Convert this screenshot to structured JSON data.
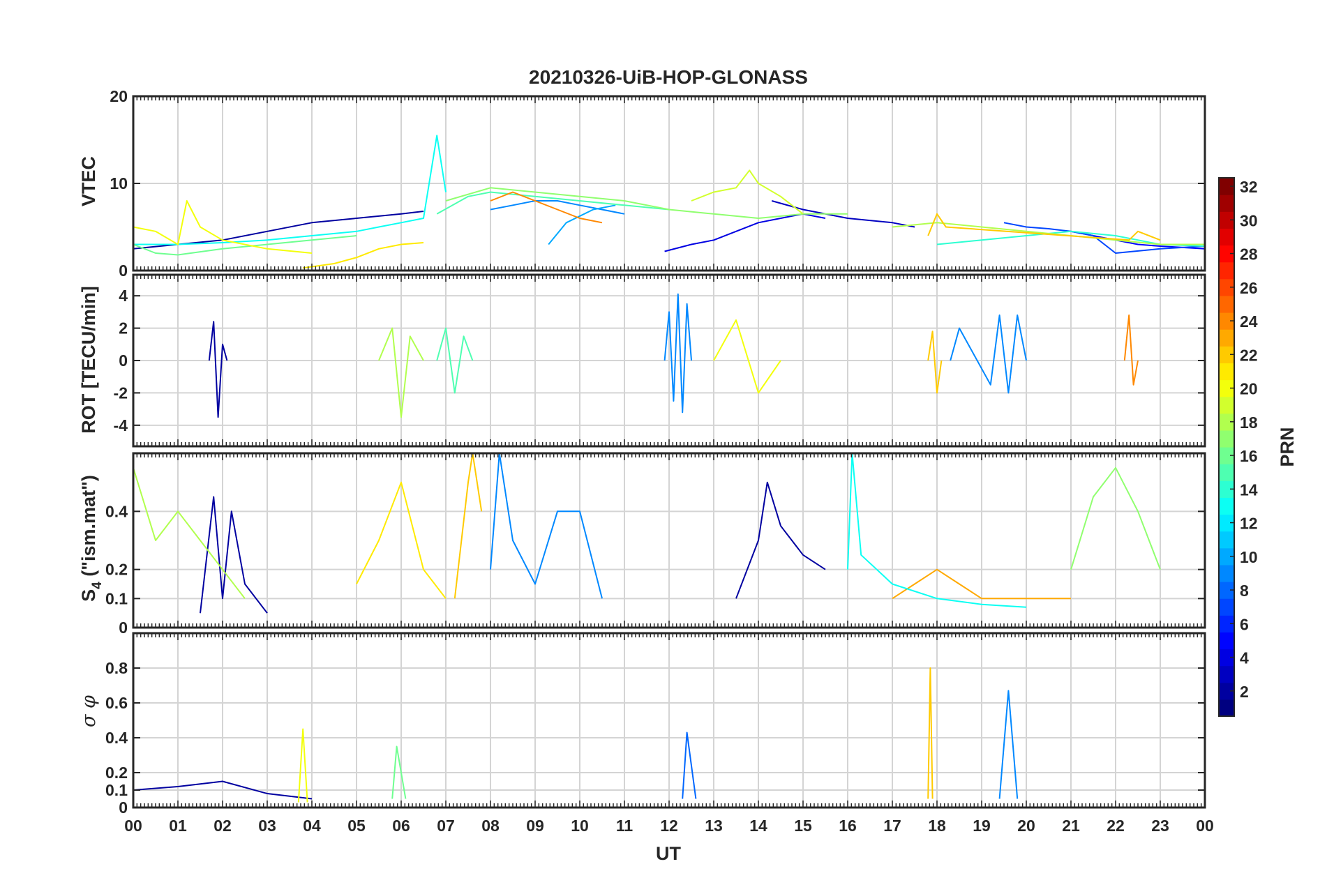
{
  "chart_data": {
    "type": "line",
    "title": "20210326-UiB-HOP-GLONASS",
    "xlabel": "UT",
    "x_unit": "hours",
    "xlim": [
      0,
      24
    ],
    "x_tick_labels": [
      "00",
      "01",
      "02",
      "03",
      "04",
      "05",
      "06",
      "07",
      "08",
      "09",
      "10",
      "11",
      "12",
      "13",
      "14",
      "15",
      "16",
      "17",
      "18",
      "19",
      "20",
      "21",
      "22",
      "23",
      "00"
    ],
    "grid": true,
    "colorbar": {
      "label": "PRN",
      "colormap": "jet",
      "range": [
        1,
        32
      ],
      "tick_labels": [
        "2",
        "4",
        "6",
        "8",
        "10",
        "12",
        "14",
        "16",
        "18",
        "20",
        "22",
        "24",
        "26",
        "28",
        "30",
        "32"
      ]
    },
    "panels": [
      {
        "id": "vtec",
        "ylabel": "VTEC",
        "ylim": [
          0,
          20
        ],
        "y_ticks": [
          0,
          10,
          20
        ],
        "y_tick_labels": [
          "0",
          "10",
          "20"
        ],
        "series": [
          {
            "prn": 2,
            "x": [
              0,
              1,
              2,
              3,
              4,
              5,
              6,
              6.5
            ],
            "y": [
              2.5,
              3,
              3.5,
              4.5,
              5.5,
              6,
              6.5,
              6.8
            ]
          },
          {
            "prn": 3,
            "x": [
              14.3,
              15,
              16,
              17,
              17.5
            ],
            "y": [
              8,
              7,
              6,
              5.5,
              5
            ]
          },
          {
            "prn": 4,
            "x": [
              11.9,
              12.5,
              13,
              13.5,
              14,
              14.5,
              15,
              15.5
            ],
            "y": [
              2.2,
              3,
              3.5,
              4.5,
              5.5,
              6,
              6.5,
              6
            ]
          },
          {
            "prn": 5,
            "x": [
              21,
              21.5,
              22,
              22.5,
              23,
              24
            ],
            "y": [
              4.5,
              4,
              3.5,
              3,
              2.8,
              2.5
            ]
          },
          {
            "prn": 7,
            "x": [
              19.5,
              20,
              20.5,
              21,
              21.5,
              22,
              23,
              24
            ],
            "y": [
              5.5,
              5,
              4.8,
              4.5,
              4,
              2,
              2.5,
              2.8
            ]
          },
          {
            "prn": 9,
            "x": [
              8,
              8.5,
              9,
              9.5,
              10,
              10.5,
              11
            ],
            "y": [
              7,
              7.5,
              8,
              8,
              7.5,
              7,
              6.5
            ]
          },
          {
            "prn": 10,
            "x": [
              9.3,
              9.7,
              10.3,
              10.8
            ],
            "y": [
              3,
              5.5,
              7,
              7.5
            ]
          },
          {
            "prn": 13,
            "x": [
              0,
              1,
              2,
              3,
              4,
              5,
              5.5,
              6,
              6.5,
              6.8,
              7
            ],
            "y": [
              3,
              3,
              3.2,
              3.5,
              4,
              4.5,
              5,
              5.5,
              6,
              15.5,
              9
            ]
          },
          {
            "prn": 14,
            "x": [
              18,
              19,
              20,
              21,
              22,
              23,
              24
            ],
            "y": [
              3,
              3.5,
              4,
              4.5,
              4,
              3,
              2.8
            ]
          },
          {
            "prn": 15,
            "x": [
              6.8,
              7.5,
              8,
              9,
              10,
              11,
              12
            ],
            "y": [
              6.5,
              8.5,
              9,
              8.5,
              8,
              7.5,
              7
            ]
          },
          {
            "prn": 16,
            "x": [
              0,
              0.5,
              1,
              2,
              3,
              4,
              5
            ],
            "y": [
              3,
              2,
              1.8,
              2.5,
              3,
              3.5,
              4
            ]
          },
          {
            "prn": 17,
            "x": [
              7,
              8,
              9,
              10,
              11,
              12,
              13,
              14,
              15,
              16
            ],
            "y": [
              8,
              9.5,
              9,
              8.5,
              8,
              7,
              6.5,
              6,
              6.5,
              6.5
            ]
          },
          {
            "prn": 18,
            "x": [
              17,
              18,
              19,
              20,
              21,
              22,
              23,
              24
            ],
            "y": [
              5,
              5.5,
              5,
              4.5,
              4,
              3.5,
              3,
              3
            ]
          },
          {
            "prn": 19,
            "x": [
              12.5,
              13,
              13.5,
              13.8,
              14,
              14.5,
              15
            ],
            "y": [
              8,
              9,
              9.5,
              11.5,
              10,
              8.5,
              6.5
            ]
          },
          {
            "prn": 20,
            "x": [
              0,
              0.5,
              1,
              1.2,
              1.5,
              2,
              3,
              4
            ],
            "y": [
              5,
              4.5,
              3,
              8,
              5,
              3.5,
              2.5,
              2
            ]
          },
          {
            "prn": 21,
            "x": [
              3.8,
              4.5,
              5,
              5.5,
              6,
              6.5
            ],
            "y": [
              0.3,
              0.8,
              1.5,
              2.5,
              3,
              3.2
            ]
          },
          {
            "prn": 22,
            "x": [
              17.8,
              18,
              18.2,
              22.3,
              22.5,
              23
            ],
            "y": [
              4,
              6.5,
              5,
              3.5,
              4.5,
              3.5
            ]
          },
          {
            "prn": 24,
            "x": [
              8,
              8.5,
              9,
              9.5,
              10,
              10.5
            ],
            "y": [
              8,
              9,
              8,
              7,
              6,
              5.5
            ]
          }
        ]
      },
      {
        "id": "rot",
        "ylabel": "ROT [TECU/min]",
        "ylim": [
          -5.3,
          5.3
        ],
        "y_ticks": [
          -4,
          -2,
          0,
          2,
          4
        ],
        "y_tick_labels": [
          "-4",
          "-2",
          "0",
          "2",
          "4"
        ],
        "series": [
          {
            "prn": 2,
            "x": [
              1.7,
              1.8,
              1.9,
              2,
              2.1
            ],
            "y": [
              0,
              2.4,
              -3.5,
              1,
              0
            ]
          },
          {
            "prn": 9,
            "x": [
              11.9,
              12,
              12.1,
              12.2,
              12.3,
              12.4,
              12.5
            ],
            "y": [
              0,
              3,
              -2.5,
              4.1,
              -3.2,
              3.5,
              0
            ]
          },
          {
            "prn": 9,
            "x": [
              18.3,
              18.5,
              19.2,
              19.4,
              19.6,
              19.8,
              20
            ],
            "y": [
              0,
              2,
              -1.5,
              2.8,
              -2,
              2.8,
              0
            ]
          },
          {
            "prn": 18,
            "x": [
              5.5,
              5.8,
              6,
              6.2,
              6.5
            ],
            "y": [
              0,
              2,
              -3.5,
              1.5,
              0
            ]
          },
          {
            "prn": 20,
            "x": [
              13,
              13.5,
              14,
              14.5
            ],
            "y": [
              0,
              2.5,
              -2,
              0
            ]
          },
          {
            "prn": 24,
            "x": [
              22.2,
              22.3,
              22.4,
              22.5
            ],
            "y": [
              0,
              2.8,
              -1.5,
              0
            ]
          },
          {
            "prn": 15,
            "x": [
              6.8,
              7,
              7.2,
              7.4,
              7.6
            ],
            "y": [
              0,
              2,
              -2,
              1.5,
              0
            ]
          },
          {
            "prn": 22,
            "x": [
              17.8,
              17.9,
              18,
              18.1
            ],
            "y": [
              0,
              1.8,
              -2,
              0
            ]
          }
        ]
      },
      {
        "id": "s4",
        "ylabel_main": "S",
        "ylabel_sub": "4",
        "ylabel_suffix": " (\"ism.mat\")",
        "ylim": [
          0,
          0.6
        ],
        "y_ticks": [
          0,
          0.1,
          0.2,
          0.4
        ],
        "y_tick_labels": [
          "0",
          "0.1",
          "0.2",
          "0.4"
        ],
        "series": [
          {
            "prn": 2,
            "x": [
              1.5,
              1.8,
              2,
              2.2,
              2.5,
              3
            ],
            "y": [
              0.05,
              0.45,
              0.1,
              0.4,
              0.15,
              0.05
            ]
          },
          {
            "prn": 2,
            "x": [
              13.5,
              14,
              14.2,
              14.5,
              15,
              15.5
            ],
            "y": [
              0.1,
              0.3,
              0.5,
              0.35,
              0.25,
              0.2
            ]
          },
          {
            "prn": 9,
            "x": [
              8,
              8.2,
              8.5,
              9,
              9.5,
              10,
              10.5
            ],
            "y": [
              0.2,
              0.6,
              0.3,
              0.15,
              0.4,
              0.4,
              0.1
            ]
          },
          {
            "prn": 18,
            "x": [
              0,
              0.5,
              1,
              1.5,
              2,
              2.5
            ],
            "y": [
              0.55,
              0.3,
              0.4,
              0.3,
              0.2,
              0.1
            ]
          },
          {
            "prn": 21,
            "x": [
              5,
              5.5,
              6,
              6.5,
              7
            ],
            "y": [
              0.15,
              0.3,
              0.5,
              0.2,
              0.1
            ]
          },
          {
            "prn": 22,
            "x": [
              7.2,
              7.5,
              7.6,
              7.8
            ],
            "y": [
              0.1,
              0.5,
              0.6,
              0.4
            ]
          },
          {
            "prn": 17,
            "x": [
              21,
              21.5,
              22,
              22.5,
              23
            ],
            "y": [
              0.2,
              0.45,
              0.55,
              0.4,
              0.2
            ]
          },
          {
            "prn": 23,
            "x": [
              17,
              17.5,
              18,
              18.5,
              19,
              20,
              21
            ],
            "y": [
              0.1,
              0.15,
              0.2,
              0.15,
              0.1,
              0.1,
              0.1
            ]
          },
          {
            "prn": 13,
            "x": [
              16,
              16.1,
              16.3,
              17,
              18,
              19,
              20
            ],
            "y": [
              0.2,
              0.6,
              0.25,
              0.15,
              0.1,
              0.08,
              0.07
            ]
          }
        ]
      },
      {
        "id": "sigma_phi",
        "ylabel": "σ φ",
        "ylim": [
          0,
          1.0
        ],
        "y_ticks": [
          0,
          0.1,
          0.2,
          0.4,
          0.6,
          0.8
        ],
        "y_tick_labels": [
          "0",
          "0.1",
          "0.2",
          "0.4",
          "0.6",
          "0.8"
        ],
        "series": [
          {
            "prn": 2,
            "x": [
              0,
              1,
              2,
              3,
              4
            ],
            "y": [
              0.1,
              0.12,
              0.15,
              0.08,
              0.05
            ]
          },
          {
            "prn": 9,
            "x": [
              19.4,
              19.6,
              19.8
            ],
            "y": [
              0.05,
              0.67,
              0.05
            ]
          },
          {
            "prn": 22,
            "x": [
              17.8,
              17.85,
              17.9
            ],
            "y": [
              0.05,
              0.8,
              0.05
            ]
          },
          {
            "prn": 8,
            "x": [
              12.3,
              12.4,
              12.6
            ],
            "y": [
              0.05,
              0.43,
              0.05
            ]
          },
          {
            "prn": 20,
            "x": [
              3.7,
              3.8,
              3.9
            ],
            "y": [
              0.03,
              0.45,
              0.03
            ]
          },
          {
            "prn": 16,
            "x": [
              5.8,
              5.9,
              6.1
            ],
            "y": [
              0.05,
              0.35,
              0.05
            ]
          }
        ]
      }
    ]
  }
}
